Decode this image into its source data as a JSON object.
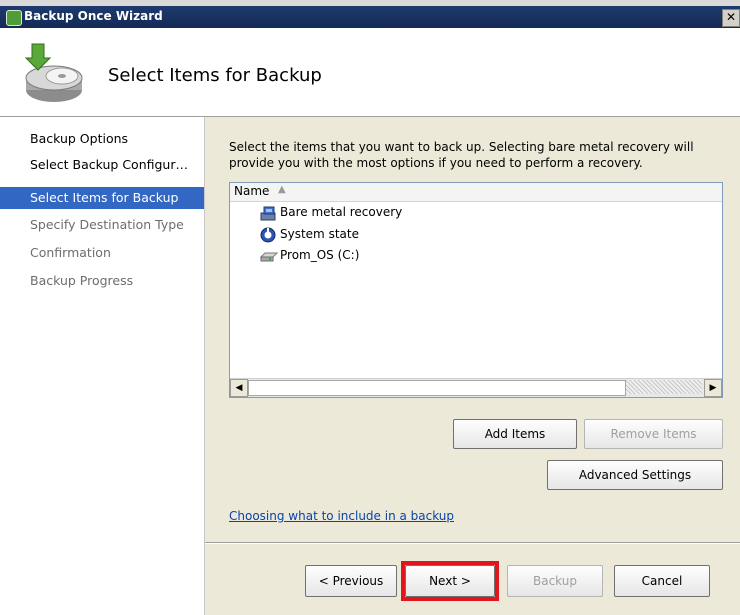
{
  "window": {
    "title": "Backup Once Wizard",
    "close_glyph": "✕"
  },
  "header": {
    "title": "Select Items for Backup",
    "icon": "backup-disk-icon"
  },
  "nav": {
    "items": [
      {
        "label": "Backup Options",
        "state": "done"
      },
      {
        "label": "Select Backup Configur…",
        "state": "done"
      },
      {
        "label": "Select Items for Backup",
        "state": "selected"
      },
      {
        "label": "Specify Destination Type",
        "state": "pending"
      },
      {
        "label": "Confirmation",
        "state": "pending"
      },
      {
        "label": "Backup Progress",
        "state": "pending"
      }
    ]
  },
  "main": {
    "description": "Select the items that you want to back up. Selecting bare metal recovery will provide you with the most options if you need to perform a recovery.",
    "list": {
      "column_name": "Name",
      "sort_glyph": "▲",
      "items": [
        {
          "label": "Bare metal recovery",
          "icon": "bare-metal-icon"
        },
        {
          "label": "System state",
          "icon": "system-state-icon"
        },
        {
          "label": "Prom_OS (C:)",
          "icon": "drive-icon"
        }
      ]
    },
    "buttons": {
      "add_items": "Add Items",
      "remove_items": "Remove Items",
      "advanced_settings": "Advanced Settings"
    },
    "link": "Choosing what to include in a backup"
  },
  "footer": {
    "previous": "< Previous",
    "next": "Next >",
    "backup": "Backup",
    "cancel": "Cancel"
  },
  "colors": {
    "selection": "#3367c4",
    "highlight": "#e0161e",
    "titlebar": "#1e3a6e",
    "link": "#0645ad"
  }
}
